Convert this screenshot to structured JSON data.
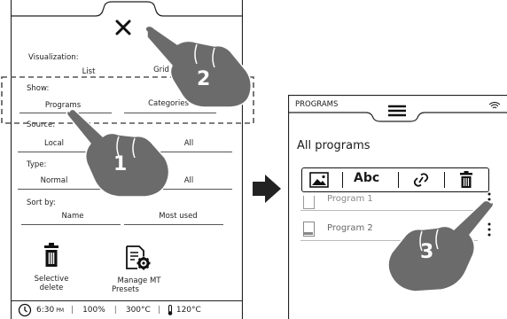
{
  "left_panel": {
    "visualization": {
      "label": "Visualization:",
      "options": [
        "List",
        "Grid"
      ]
    },
    "show": {
      "label": "Show:",
      "options": [
        "Programs",
        "Categories"
      ]
    },
    "source": {
      "label": "Source:",
      "options": [
        "Local",
        "All"
      ]
    },
    "type": {
      "label": "Type:",
      "options": [
        "Normal",
        "All"
      ]
    },
    "sort_by": {
      "label": "Sort by:",
      "options": [
        "Name",
        "Most used"
      ]
    },
    "actions": [
      {
        "label_line1": "Selective",
        "label_line2": "delete",
        "icon": "trash-icon"
      },
      {
        "label_line1": "Manage MT",
        "label_line2": "Presets",
        "icon": "document-gear-icon"
      }
    ],
    "status_bar": {
      "time": "6:30",
      "time_suffix": "PM",
      "power": "100%",
      "temp1": "300°C",
      "temp2": "120°C"
    }
  },
  "right_panel": {
    "header_title": "PROGRAMS",
    "title": "All programs",
    "toolbar": {
      "text_button": "Abc"
    },
    "programs": [
      "Program 1",
      "Program 2"
    ]
  },
  "callouts": [
    "1",
    "2",
    "3"
  ],
  "colors": {
    "hand": "#6b6b6b",
    "arrow": "#222222",
    "dashed": "#555555"
  }
}
